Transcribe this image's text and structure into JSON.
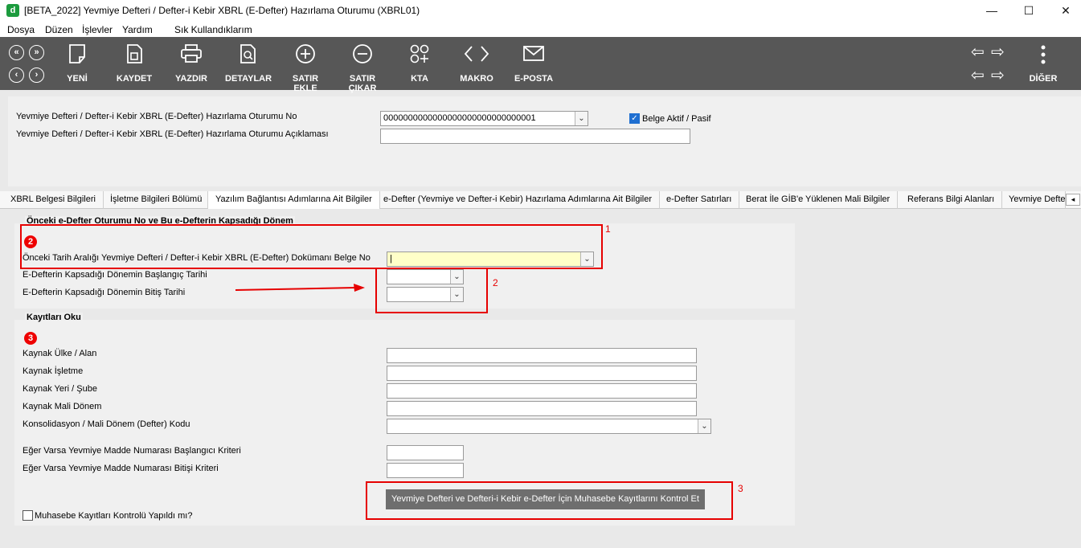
{
  "window": {
    "app_icon": "d",
    "title": "[BETA_2022] Yevmiye Defteri / Defter-i Kebir XBRL (E-Defter) Hazırlama Oturumu (XBRL01)",
    "minimize": "—",
    "maximize": "☐",
    "close": "✕"
  },
  "menu": [
    "Dosya",
    "Düzen",
    "İşlevler",
    "Yardım",
    "Sık Kullandıklarım"
  ],
  "toolbar": {
    "buttons": [
      {
        "label": "YENİ",
        "icon": "new-document-icon"
      },
      {
        "label": "KAYDET",
        "icon": "save-icon"
      },
      {
        "label": "YAZDIR",
        "icon": "printer-icon"
      },
      {
        "label": "DETAYLAR",
        "icon": "details-search-icon"
      },
      {
        "label": "SATIR EKLE",
        "icon": "add-row-icon"
      },
      {
        "label": "SATIR ÇIKAR",
        "icon": "remove-row-icon"
      },
      {
        "label": "KTA",
        "icon": "kta-icon"
      },
      {
        "label": "MAKRO",
        "icon": "code-icon"
      },
      {
        "label": "E-POSTA",
        "icon": "mail-icon"
      },
      {
        "label": "DİĞER",
        "icon": "more-vertical-icon"
      }
    ]
  },
  "header": {
    "session_no_label": "Yevmiye Defteri / Defter-i Kebir XBRL (E-Defter) Hazırlama Oturumu No",
    "session_no_value": "0000000000000000000000000000001",
    "session_desc_label": "Yevmiye Defteri / Defter-i Kebir XBRL (E-Defter) Hazırlama Oturumu Açıklaması",
    "session_desc_value": "",
    "active_label": "Belge Aktif / Pasif",
    "active_checked": true
  },
  "tabs": [
    "XBRL Belgesi Bilgileri",
    "İşletme Bilgileri Bölümü",
    "Yazılım Bağlantısı Adımlarına Ait Bilgiler",
    "e-Defter (Yevmiye ve Defter-i Kebir) Hazırlama Adımlarına Ait Bilgiler",
    "e-Defter Satırları",
    "Berat İle GİB'e Yüklenen Mali Bilgiler",
    "Referans Bilgi Alanları",
    "Yevmiye Defte"
  ],
  "active_tab_index": 2,
  "section1": {
    "title": "Önceki e-Defter Oturumu No ve Bu e-Defterin Kapsadığı Dönem",
    "badge": "2",
    "prev_doc_label": "Önceki Tarih Aralığı Yevmiye Defteri / Defter-i Kebir XBRL (E-Defter) Dokümanı Belge No",
    "prev_doc_value": "|",
    "start_label": "E-Defterin Kapsadığı Dönemin Başlangıç Tarihi",
    "end_label": "E-Defterin Kapsadığı Dönemin Bitiş Tarihi",
    "annotation1": "1",
    "annotation2": "2"
  },
  "section2": {
    "title": "Kayıtları Oku",
    "badge": "3",
    "fields": [
      "Kaynak Ülke / Alan",
      "Kaynak İşletme",
      "Kaynak Yeri / Şube",
      "Kaynak Mali Dönem",
      "Konsolidasyon / Mali Dönem (Defter) Kodu"
    ],
    "start_crit_label": "Eğer Varsa Yevmiye Madde Numarası Başlangıcı Kriteri",
    "end_crit_label": "Eğer Varsa Yevmiye Madde Numarası Bitişi Kriteri",
    "check_button": "Yevmiye Defteri ve Defteri-i Kebir e-Defter İçin Muhasebe Kayıtlarını Kontrol Et",
    "annotation3": "3",
    "control_check_label": "Muhasebe Kayıtları Kontrolü Yapıldı mı?"
  },
  "colors": {
    "toolbar": "#575757",
    "annotation": "#e60000",
    "highlight_field": "#ffffc8"
  }
}
